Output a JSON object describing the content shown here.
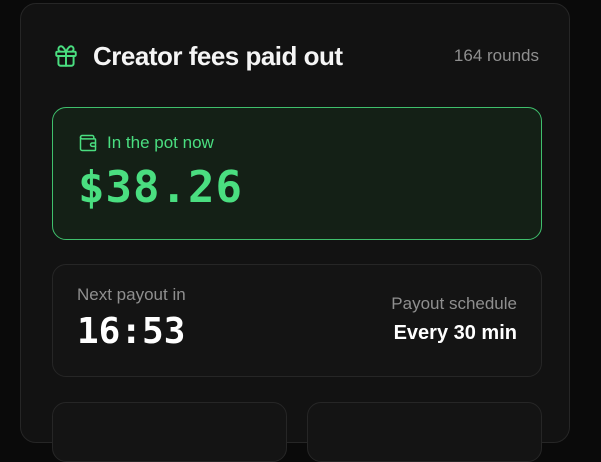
{
  "header": {
    "title": "Creator fees paid out",
    "rounds": "164 rounds",
    "icon": "gift-icon"
  },
  "pot": {
    "label": "In the pot now",
    "amount": "$38.26",
    "icon": "wallet-icon"
  },
  "payout": {
    "next_label": "Next payout in",
    "countdown": "16:53",
    "schedule_label": "Payout schedule",
    "schedule_value": "Every 30 min"
  },
  "colors": {
    "accent": "#4ade80",
    "background": "#0a0a0a",
    "card": "#121212"
  }
}
